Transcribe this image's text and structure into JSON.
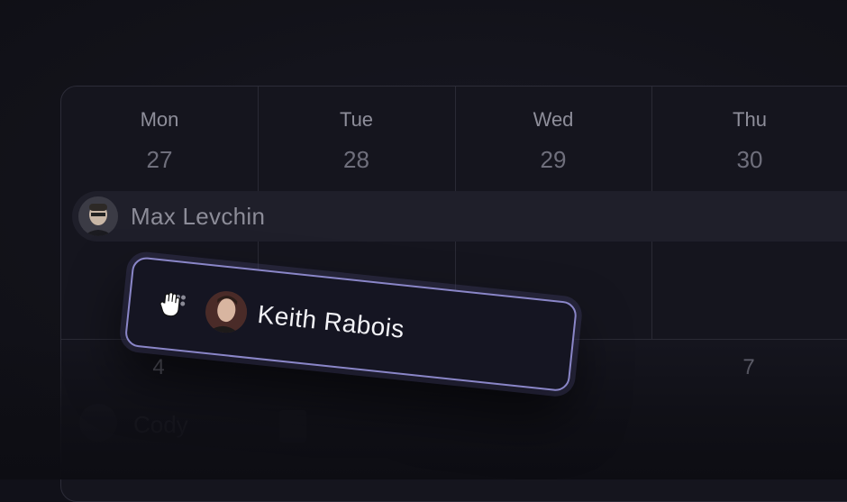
{
  "week1": {
    "days": [
      {
        "name": "Mon",
        "date": "27"
      },
      {
        "name": "Tue",
        "date": "28"
      },
      {
        "name": "Wed",
        "date": "29"
      },
      {
        "name": "Thu",
        "date": "30"
      }
    ]
  },
  "week2": {
    "dates": [
      "4",
      "7"
    ]
  },
  "events": {
    "scheduled_person": "Max Levchin",
    "dragged_person": "Keith Rabois",
    "ghost_person_partial": "Cody"
  },
  "colors": {
    "background": "#111119",
    "card_border": "#8a86c8",
    "event_bar": "#1f1f2a"
  },
  "icons": {
    "drag_cursor": "grab-hand-icon"
  }
}
